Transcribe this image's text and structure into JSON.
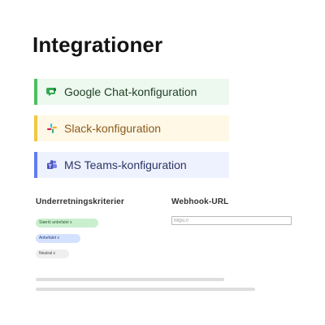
{
  "page": {
    "title": "Integrationer"
  },
  "integrations": [
    {
      "label": "Google Chat-konfiguration",
      "icon": "google-chat-icon",
      "accent": "#4cbf5e"
    },
    {
      "label": "Slack-konfiguration",
      "icon": "slack-icon",
      "accent": "#f2c744"
    },
    {
      "label": "MS Teams-konfiguration",
      "icon": "ms-teams-icon",
      "accent": "#5f7cf2"
    }
  ],
  "criteria": {
    "heading": "Underretningskriterier",
    "chips": [
      {
        "label": "Stærkt anbefalet x",
        "color": "#c9efcf"
      },
      {
        "label": "Anbefalet x",
        "color": "#d5e2ff"
      },
      {
        "label": "Neutral x",
        "color": "#efefef"
      }
    ]
  },
  "webhook": {
    "heading": "Webhook-URL",
    "placeholder": "https://",
    "value": ""
  }
}
